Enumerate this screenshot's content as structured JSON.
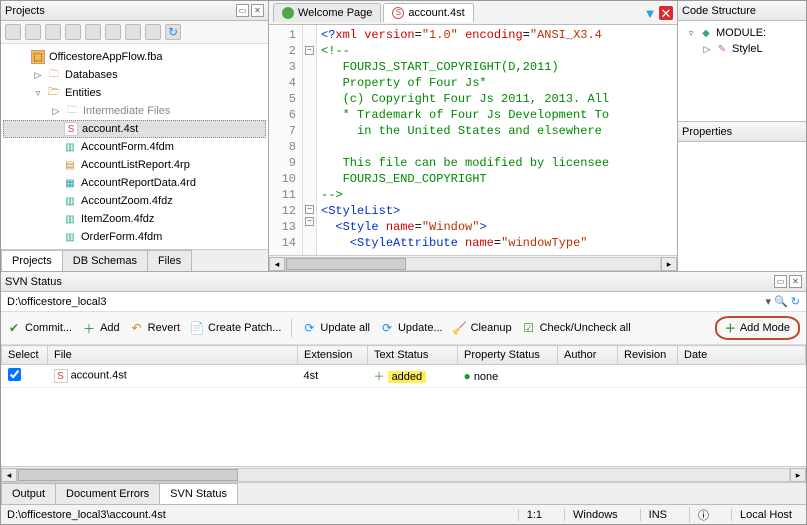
{
  "projects": {
    "title": "Projects",
    "tree": {
      "root": "OfficestoreAppFlow.fba",
      "databases": "Databases",
      "entities": "Entities",
      "intermediate": "Intermediate Files",
      "files": [
        "account.4st",
        "AccountForm.4fdm",
        "AccountListReport.4rp",
        "AccountReportData.4rd",
        "AccountZoom.4fdz",
        "ItemZoom.4fdz",
        "OrderForm.4fdm"
      ]
    },
    "tabs": {
      "projects": "Projects",
      "db": "DB Schemas",
      "files": "Files"
    }
  },
  "editor": {
    "tabs": {
      "welcome": "Welcome Page",
      "file": "account.4st"
    },
    "lines": [
      {
        "n": 1,
        "seg": [
          {
            "t": "<?",
            "c": "blue"
          },
          {
            "t": "xml ",
            "c": "red"
          },
          {
            "t": "version",
            "c": "red"
          },
          {
            "t": "=",
            "c": ""
          },
          {
            "t": "\"1.0\" ",
            "c": "str"
          },
          {
            "t": "encoding",
            "c": "red"
          },
          {
            "t": "=",
            "c": ""
          },
          {
            "t": "\"ANSI_X3.4",
            "c": "str"
          }
        ]
      },
      {
        "n": 2,
        "seg": [
          {
            "t": "<!--",
            "c": "grn"
          }
        ]
      },
      {
        "n": 3,
        "seg": [
          {
            "t": "   FOURJS_START_COPYRIGHT(D,2011)",
            "c": "grn"
          }
        ]
      },
      {
        "n": 4,
        "seg": [
          {
            "t": "   Property of Four Js*",
            "c": "grn"
          }
        ]
      },
      {
        "n": 5,
        "seg": [
          {
            "t": "   (c) Copyright Four Js 2011, 2013. All",
            "c": "grn"
          }
        ]
      },
      {
        "n": 6,
        "seg": [
          {
            "t": "   * Trademark of Four Js Development To",
            "c": "grn"
          }
        ]
      },
      {
        "n": 7,
        "seg": [
          {
            "t": "     in the United States and elsewhere",
            "c": "grn"
          }
        ]
      },
      {
        "n": 8,
        "seg": [
          {
            "t": " ",
            "c": "grn"
          }
        ]
      },
      {
        "n": 9,
        "seg": [
          {
            "t": "   This file can be modified by licensee",
            "c": "grn"
          }
        ]
      },
      {
        "n": 10,
        "seg": [
          {
            "t": "   FOURJS_END_COPYRIGHT",
            "c": "grn"
          }
        ]
      },
      {
        "n": 11,
        "seg": [
          {
            "t": "-->",
            "c": "grn"
          }
        ]
      },
      {
        "n": 12,
        "seg": [
          {
            "t": "<",
            "c": "blue"
          },
          {
            "t": "StyleList",
            "c": "blue"
          },
          {
            "t": ">",
            "c": "blue"
          }
        ]
      },
      {
        "n": 13,
        "seg": [
          {
            "t": "  <",
            "c": "blue"
          },
          {
            "t": "Style ",
            "c": "blue"
          },
          {
            "t": "name",
            "c": "red"
          },
          {
            "t": "=",
            "c": ""
          },
          {
            "t": "\"Window\"",
            "c": "str"
          },
          {
            "t": ">",
            "c": "blue"
          }
        ]
      },
      {
        "n": 14,
        "seg": [
          {
            "t": "    <",
            "c": "blue"
          },
          {
            "t": "StyleAttribute ",
            "c": "blue"
          },
          {
            "t": "name",
            "c": "red"
          },
          {
            "t": "=",
            "c": ""
          },
          {
            "t": "\"windowType\"",
            "c": "str"
          }
        ]
      }
    ]
  },
  "codestructure": {
    "title": "Code Structure",
    "module": "MODULE:",
    "child": "StyleL"
  },
  "properties": {
    "title": "Properties"
  },
  "svn": {
    "title": "SVN Status",
    "path": "D:\\officestore_local3",
    "toolbar": {
      "commit": "Commit...",
      "add": "Add",
      "revert": "Revert",
      "patch": "Create Patch...",
      "updateall": "Update all",
      "update": "Update...",
      "cleanup": "Cleanup",
      "check": "Check/Uncheck all",
      "addmode": "Add Mode"
    },
    "headers": {
      "select": "Select",
      "file": "File",
      "ext": "Extension",
      "text": "Text Status",
      "prop": "Property Status",
      "author": "Author",
      "rev": "Revision",
      "date": "Date"
    },
    "row": {
      "file": "account.4st",
      "ext": "4st",
      "text": "added",
      "prop": "none"
    },
    "bottomtabs": {
      "output": "Output",
      "docerr": "Document Errors",
      "svn": "SVN Status"
    }
  },
  "status": {
    "path": "D:\\officestore_local3\\account.4st",
    "pos": "1:1",
    "os": "Windows",
    "ins": "INS",
    "host": "Local Host"
  }
}
